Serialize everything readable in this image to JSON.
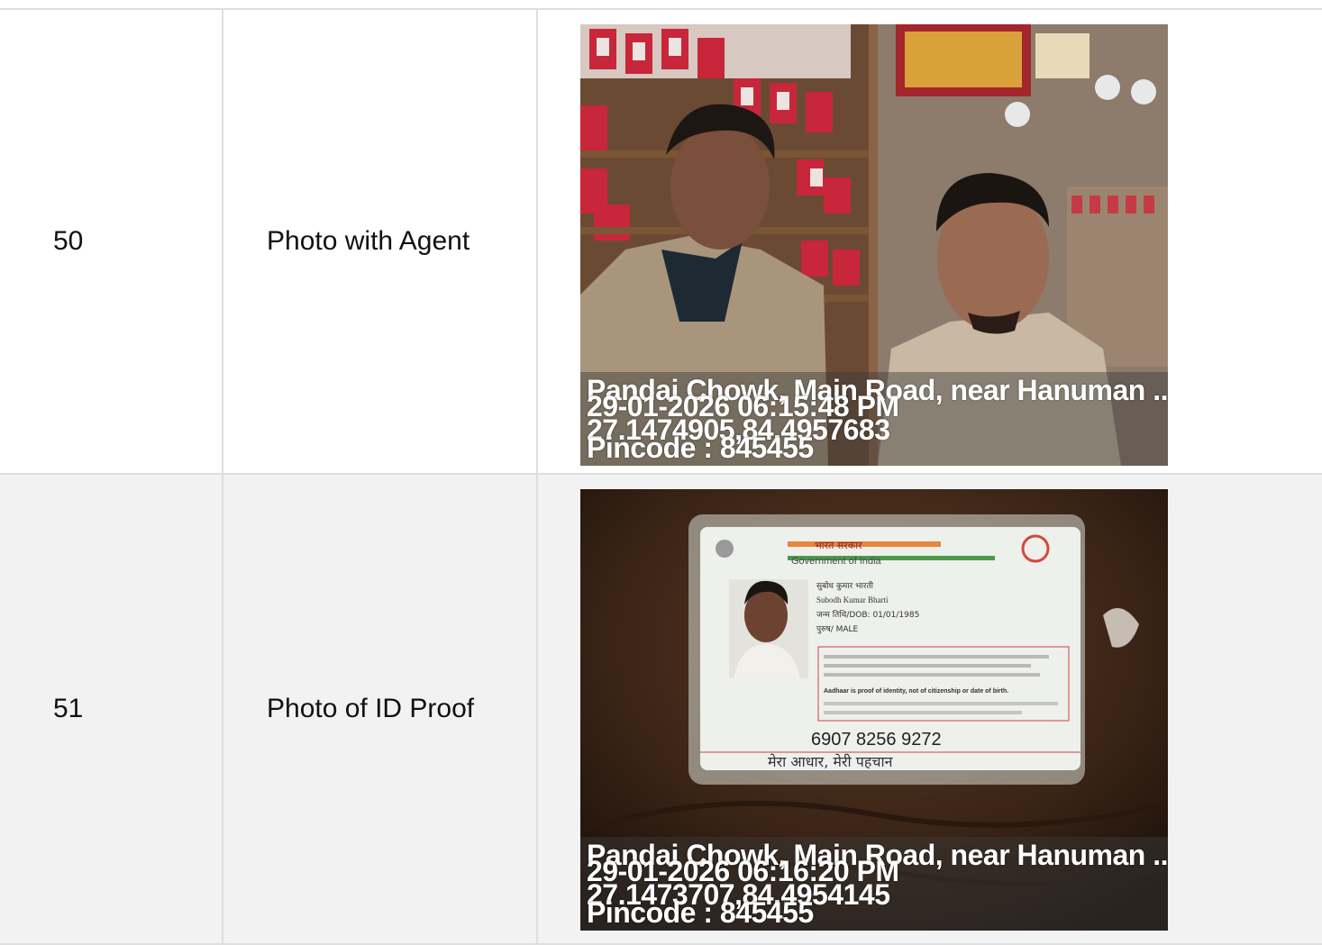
{
  "rows": [
    {
      "number": "50",
      "label": "Photo with Agent",
      "stamp": {
        "address": "Pandai Chowk, Main Road, near Hanuman ...",
        "datetime": "29-01-2026 06:15:48 PM",
        "coordinates": "27.1474905,84.4957683",
        "pincode": "Pincode : 845455"
      }
    },
    {
      "number": "51",
      "label": "Photo of ID Proof",
      "stamp": {
        "address": "Pandai Chowk, Main Road, near Hanuman ...",
        "datetime": "29-01-2026 06:16:20 PM",
        "coordinates": "27.1473707,84.4954145",
        "pincode": "Pincode : 845455"
      },
      "id_card": {
        "header_hindi": "भारत सरकार",
        "header_english": "Government of India",
        "name_hindi": "सुबोध कुमार भारती",
        "name_english": "Subodh Kumar Bharti",
        "dob": "जन्म तिथि/DOB: 01/01/1985",
        "gender": "पुरुष/ MALE",
        "notice": "Aadhaar is proof of identity, not of citizenship or date of birth.",
        "number": "6907 8256 9272",
        "footer": "मेरा आधार, मेरी पहचान"
      }
    }
  ]
}
